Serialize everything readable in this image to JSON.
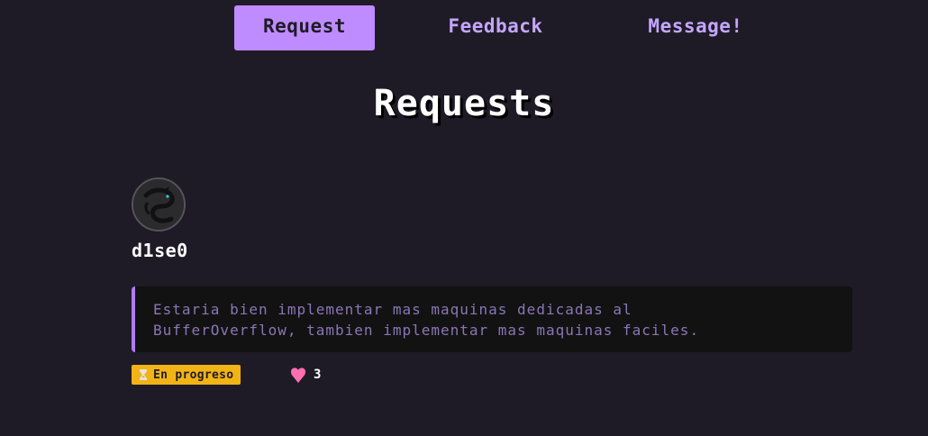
{
  "nav": {
    "tabs": [
      {
        "label": "Request",
        "active": true
      },
      {
        "label": "Feedback",
        "active": false
      },
      {
        "label": "Message!",
        "active": false
      }
    ]
  },
  "page": {
    "title": "Requests"
  },
  "request": {
    "username": "d1se0",
    "avatar_icon": "dragon-avatar-icon",
    "text": "Estaria bien implementar mas maquinas dedicadas al\nBufferOverflow, tambien implementar mas maquinas faciles.",
    "status": {
      "icon": "hourglass-icon",
      "label": "En progreso"
    },
    "likes": {
      "icon": "heart-icon",
      "count": "3"
    }
  },
  "colors": {
    "background": "#1e1b26",
    "accent": "#bf8cff",
    "nav_text": "#c4a6ff",
    "card_border": "#b07cf3",
    "card_text": "#8a76b5",
    "status_badge": "#f2b316",
    "heart": "#ff6fb0"
  }
}
